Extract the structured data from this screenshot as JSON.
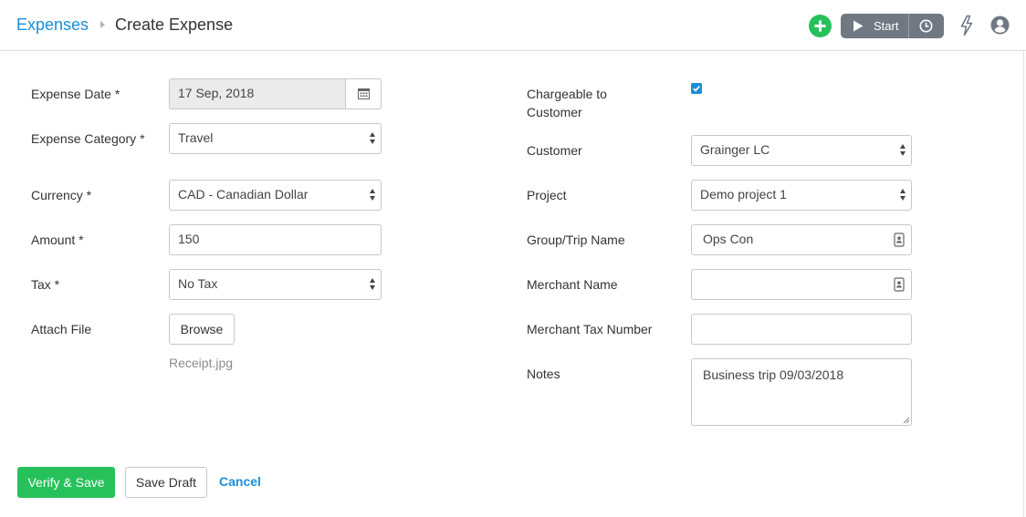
{
  "header": {
    "breadcrumb_root": "Expenses",
    "page_title": "Create Expense",
    "start_label": "Start"
  },
  "form": {
    "expense_date": {
      "label": "Expense Date *",
      "value": "17 Sep, 2018"
    },
    "expense_category": {
      "label": "Expense Category *",
      "value": "Travel"
    },
    "currency": {
      "label": "Currency *",
      "value": "CAD - Canadian Dollar"
    },
    "amount": {
      "label": "Amount *",
      "value": "150"
    },
    "tax": {
      "label": "Tax *",
      "value": "No Tax"
    },
    "attach_file": {
      "label": "Attach File",
      "button": "Browse",
      "file_name": "Receipt.jpg"
    },
    "chargeable": {
      "label": "Chargeable to Customer",
      "checked": true
    },
    "customer": {
      "label": "Customer",
      "value": "Grainger LC"
    },
    "project": {
      "label": "Project",
      "value": "Demo project 1"
    },
    "group_trip": {
      "label": "Group/Trip Name",
      "value": "Ops Con"
    },
    "merchant_name": {
      "label": "Merchant Name",
      "value": ""
    },
    "merchant_tax_number": {
      "label": "Merchant Tax Number",
      "value": ""
    },
    "notes": {
      "label": "Notes",
      "value": "Business trip 09/03/2018"
    }
  },
  "actions": {
    "verify_save": "Verify & Save",
    "save_draft": "Save Draft",
    "cancel": "Cancel"
  },
  "colors": {
    "accent": "#1a8ed6",
    "success": "#27c15b",
    "timer_bg": "#707882"
  },
  "icons": [
    "chevron-right-icon",
    "plus-icon",
    "play-icon",
    "clock-icon",
    "bolt-icon",
    "user-icon",
    "calendar-icon",
    "checkmark-icon",
    "contact-card-icon",
    "resize-grip-icon"
  ]
}
